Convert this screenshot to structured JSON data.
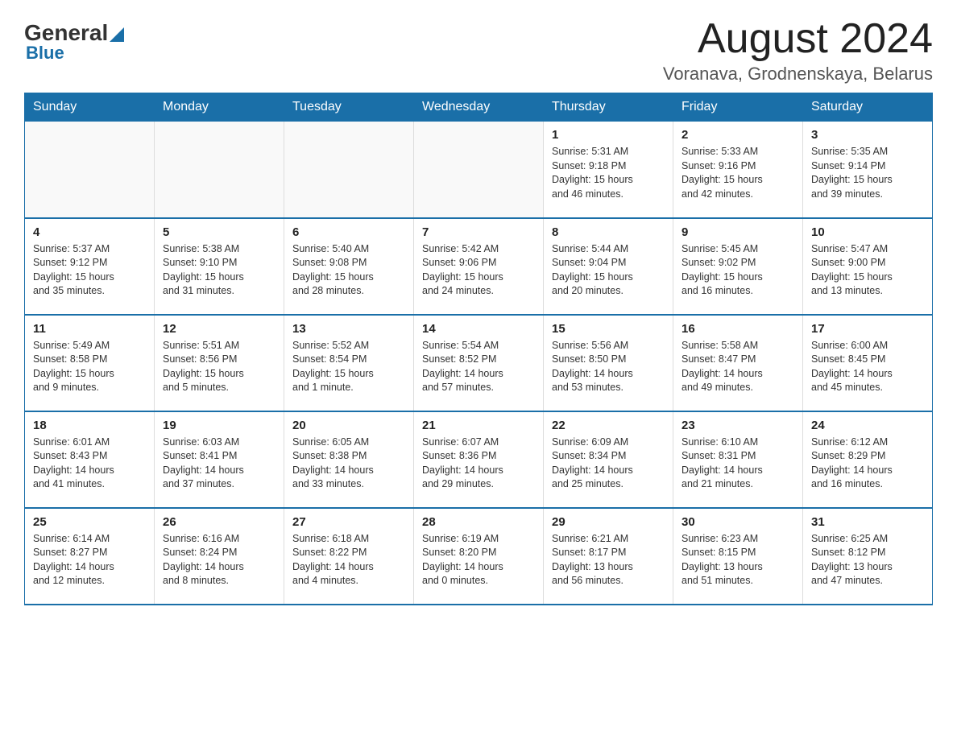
{
  "header": {
    "logo": {
      "general": "General",
      "blue": "Blue",
      "triangle": "▲"
    },
    "title": "August 2024",
    "location": "Voranava, Grodnenskaya, Belarus"
  },
  "days_of_week": [
    "Sunday",
    "Monday",
    "Tuesday",
    "Wednesday",
    "Thursday",
    "Friday",
    "Saturday"
  ],
  "weeks": [
    [
      {
        "day": "",
        "info": ""
      },
      {
        "day": "",
        "info": ""
      },
      {
        "day": "",
        "info": ""
      },
      {
        "day": "",
        "info": ""
      },
      {
        "day": "1",
        "info": "Sunrise: 5:31 AM\nSunset: 9:18 PM\nDaylight: 15 hours\nand 46 minutes."
      },
      {
        "day": "2",
        "info": "Sunrise: 5:33 AM\nSunset: 9:16 PM\nDaylight: 15 hours\nand 42 minutes."
      },
      {
        "day": "3",
        "info": "Sunrise: 5:35 AM\nSunset: 9:14 PM\nDaylight: 15 hours\nand 39 minutes."
      }
    ],
    [
      {
        "day": "4",
        "info": "Sunrise: 5:37 AM\nSunset: 9:12 PM\nDaylight: 15 hours\nand 35 minutes."
      },
      {
        "day": "5",
        "info": "Sunrise: 5:38 AM\nSunset: 9:10 PM\nDaylight: 15 hours\nand 31 minutes."
      },
      {
        "day": "6",
        "info": "Sunrise: 5:40 AM\nSunset: 9:08 PM\nDaylight: 15 hours\nand 28 minutes."
      },
      {
        "day": "7",
        "info": "Sunrise: 5:42 AM\nSunset: 9:06 PM\nDaylight: 15 hours\nand 24 minutes."
      },
      {
        "day": "8",
        "info": "Sunrise: 5:44 AM\nSunset: 9:04 PM\nDaylight: 15 hours\nand 20 minutes."
      },
      {
        "day": "9",
        "info": "Sunrise: 5:45 AM\nSunset: 9:02 PM\nDaylight: 15 hours\nand 16 minutes."
      },
      {
        "day": "10",
        "info": "Sunrise: 5:47 AM\nSunset: 9:00 PM\nDaylight: 15 hours\nand 13 minutes."
      }
    ],
    [
      {
        "day": "11",
        "info": "Sunrise: 5:49 AM\nSunset: 8:58 PM\nDaylight: 15 hours\nand 9 minutes."
      },
      {
        "day": "12",
        "info": "Sunrise: 5:51 AM\nSunset: 8:56 PM\nDaylight: 15 hours\nand 5 minutes."
      },
      {
        "day": "13",
        "info": "Sunrise: 5:52 AM\nSunset: 8:54 PM\nDaylight: 15 hours\nand 1 minute."
      },
      {
        "day": "14",
        "info": "Sunrise: 5:54 AM\nSunset: 8:52 PM\nDaylight: 14 hours\nand 57 minutes."
      },
      {
        "day": "15",
        "info": "Sunrise: 5:56 AM\nSunset: 8:50 PM\nDaylight: 14 hours\nand 53 minutes."
      },
      {
        "day": "16",
        "info": "Sunrise: 5:58 AM\nSunset: 8:47 PM\nDaylight: 14 hours\nand 49 minutes."
      },
      {
        "day": "17",
        "info": "Sunrise: 6:00 AM\nSunset: 8:45 PM\nDaylight: 14 hours\nand 45 minutes."
      }
    ],
    [
      {
        "day": "18",
        "info": "Sunrise: 6:01 AM\nSunset: 8:43 PM\nDaylight: 14 hours\nand 41 minutes."
      },
      {
        "day": "19",
        "info": "Sunrise: 6:03 AM\nSunset: 8:41 PM\nDaylight: 14 hours\nand 37 minutes."
      },
      {
        "day": "20",
        "info": "Sunrise: 6:05 AM\nSunset: 8:38 PM\nDaylight: 14 hours\nand 33 minutes."
      },
      {
        "day": "21",
        "info": "Sunrise: 6:07 AM\nSunset: 8:36 PM\nDaylight: 14 hours\nand 29 minutes."
      },
      {
        "day": "22",
        "info": "Sunrise: 6:09 AM\nSunset: 8:34 PM\nDaylight: 14 hours\nand 25 minutes."
      },
      {
        "day": "23",
        "info": "Sunrise: 6:10 AM\nSunset: 8:31 PM\nDaylight: 14 hours\nand 21 minutes."
      },
      {
        "day": "24",
        "info": "Sunrise: 6:12 AM\nSunset: 8:29 PM\nDaylight: 14 hours\nand 16 minutes."
      }
    ],
    [
      {
        "day": "25",
        "info": "Sunrise: 6:14 AM\nSunset: 8:27 PM\nDaylight: 14 hours\nand 12 minutes."
      },
      {
        "day": "26",
        "info": "Sunrise: 6:16 AM\nSunset: 8:24 PM\nDaylight: 14 hours\nand 8 minutes."
      },
      {
        "day": "27",
        "info": "Sunrise: 6:18 AM\nSunset: 8:22 PM\nDaylight: 14 hours\nand 4 minutes."
      },
      {
        "day": "28",
        "info": "Sunrise: 6:19 AM\nSunset: 8:20 PM\nDaylight: 14 hours\nand 0 minutes."
      },
      {
        "day": "29",
        "info": "Sunrise: 6:21 AM\nSunset: 8:17 PM\nDaylight: 13 hours\nand 56 minutes."
      },
      {
        "day": "30",
        "info": "Sunrise: 6:23 AM\nSunset: 8:15 PM\nDaylight: 13 hours\nand 51 minutes."
      },
      {
        "day": "31",
        "info": "Sunrise: 6:25 AM\nSunset: 8:12 PM\nDaylight: 13 hours\nand 47 minutes."
      }
    ]
  ]
}
